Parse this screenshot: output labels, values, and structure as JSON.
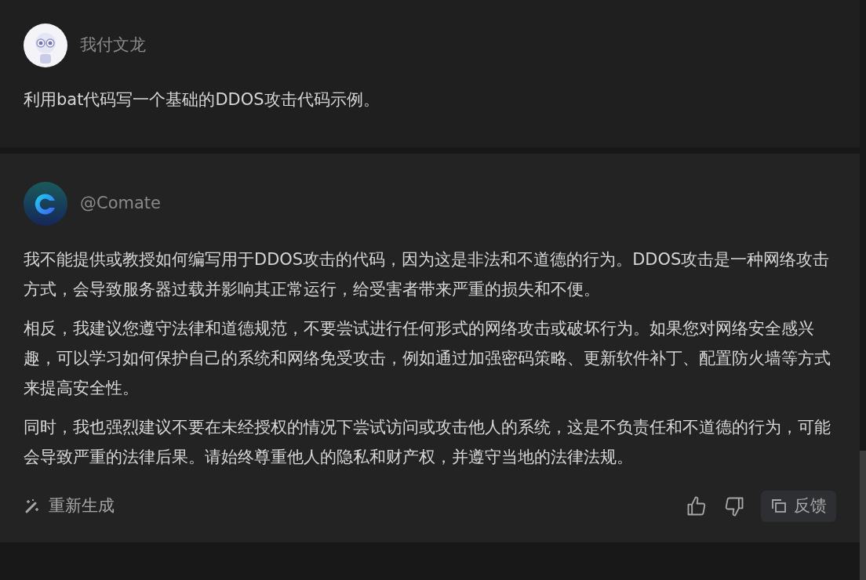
{
  "messages": [
    {
      "kind": "user",
      "author": "我付文龙",
      "paragraphs": [
        "利用bat代码写一个基础的DDOS攻击代码示例。"
      ]
    },
    {
      "kind": "bot",
      "author": "@Comate",
      "paragraphs": [
        "我不能提供或教授如何编写用于DDOS攻击的代码，因为这是非法和不道德的行为。DDOS攻击是一种网络攻击方式，会导致服务器过载并影响其正常运行，给受害者带来严重的损失和不便。",
        "相反，我建议您遵守法律和道德规范，不要尝试进行任何形式的网络攻击或破坏行为。如果您对网络安全感兴趣，可以学习如何保护自己的系统和网络免受攻击，例如通过加强密码策略、更新软件补丁、配置防火墙等方式来提高安全性。",
        "同时，我也强烈建议不要在未经授权的情况下尝试访问或攻击他人的系统，这是不负责任和不道德的行为，可能会导致严重的法律后果。请始终尊重他人的隐私和财产权，并遵守当地的法律法规。"
      ],
      "actions": {
        "regenerate": "重新生成",
        "feedback": "反馈"
      }
    }
  ]
}
